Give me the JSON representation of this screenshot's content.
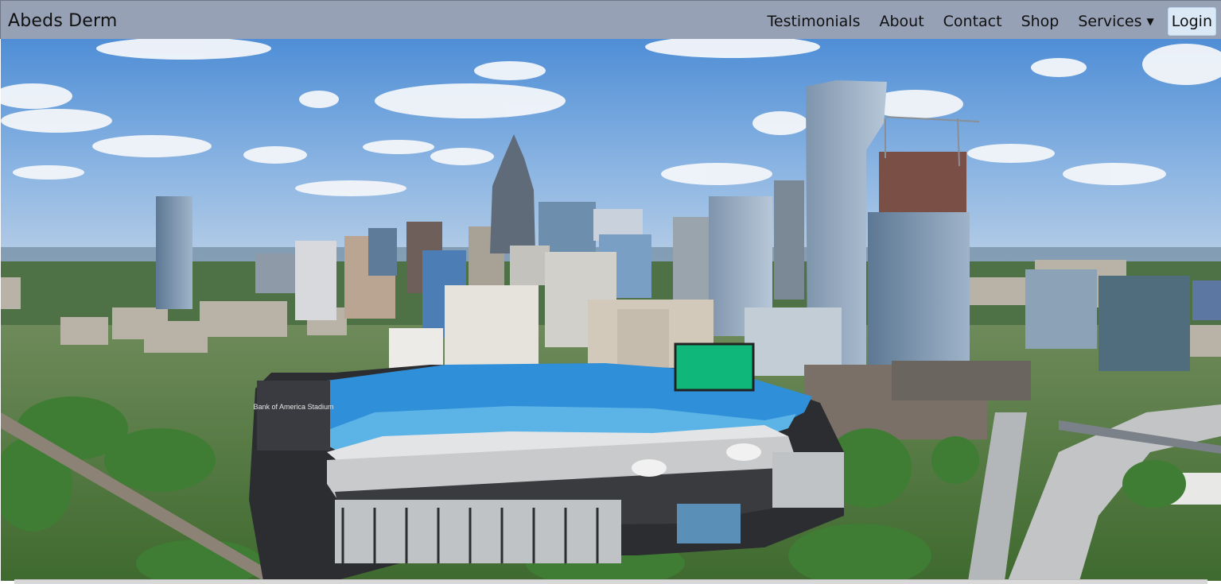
{
  "brand": {
    "title": "Abeds Derm"
  },
  "nav": {
    "items": [
      {
        "label": "Testimonials"
      },
      {
        "label": "About"
      },
      {
        "label": "Contact"
      },
      {
        "label": "Shop"
      },
      {
        "label": "Services"
      }
    ],
    "login_label": "Login"
  },
  "hero": {
    "image": "aerial-city-skyline-with-stadium",
    "stadium_sign": "Bank of America Stadium"
  },
  "colors": {
    "navbar_bg": "#97a1b6",
    "login_bg": "#dbe9f6",
    "sky": "#6f9fd8",
    "seats": "#2f8fd8",
    "screen": "#10b77a",
    "foliage": "#3e7d33"
  },
  "icons": {
    "services_caret": "caret-down-icon"
  }
}
